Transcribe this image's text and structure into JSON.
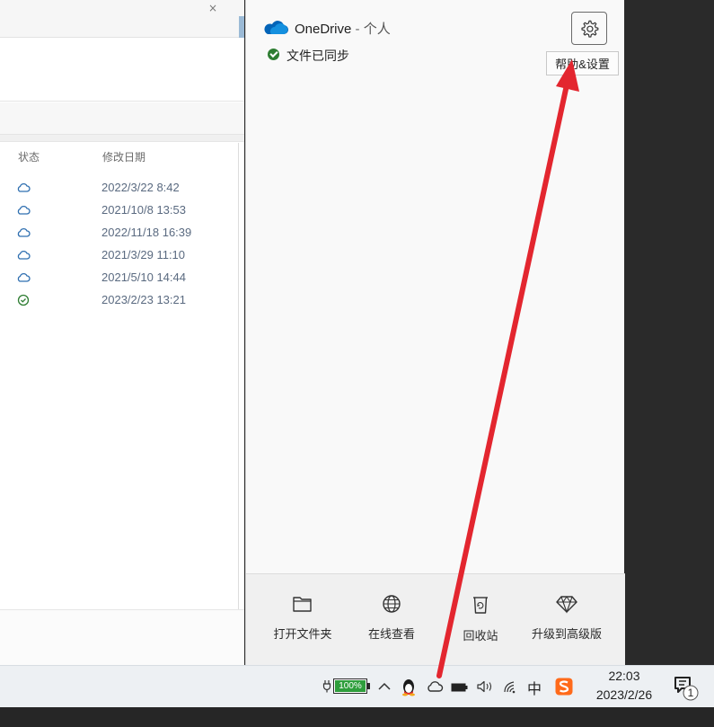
{
  "explorer": {
    "close_glyph": "×",
    "columns": {
      "status": "状态",
      "modified": "修改日期"
    },
    "rows": [
      {
        "status_icon": "cloud-icon",
        "date": "2022/3/22 8:42"
      },
      {
        "status_icon": "cloud-icon",
        "date": "2021/10/8 13:53"
      },
      {
        "status_icon": "cloud-icon",
        "date": "2022/11/18 16:39"
      },
      {
        "status_icon": "cloud-icon",
        "date": "2021/3/29 11:10"
      },
      {
        "status_icon": "cloud-icon",
        "date": "2021/5/10 14:44"
      },
      {
        "status_icon": "check-circle-icon",
        "date": "2023/2/23 13:21"
      }
    ]
  },
  "onedrive": {
    "app_name": "OneDrive",
    "separator": " - ",
    "account": "个人",
    "sync_status": "文件已同步",
    "settings_tooltip": "帮助&设置",
    "footer": [
      {
        "label": "打开文件夹",
        "icon": "folder-icon"
      },
      {
        "label": "在线查看",
        "icon": "globe-icon"
      },
      {
        "label": "回收站",
        "icon": "recycle-bin-icon"
      },
      {
        "label": "升级到高级版",
        "icon": "diamond-icon"
      }
    ],
    "accent_color": "#0364b8"
  },
  "taskbar": {
    "battery_percent": "100%",
    "ime_label": "中",
    "time": "22:03",
    "date": "2023/2/26",
    "notification_count": "1"
  },
  "annotation": {
    "arrow_color": "#e3262f"
  }
}
